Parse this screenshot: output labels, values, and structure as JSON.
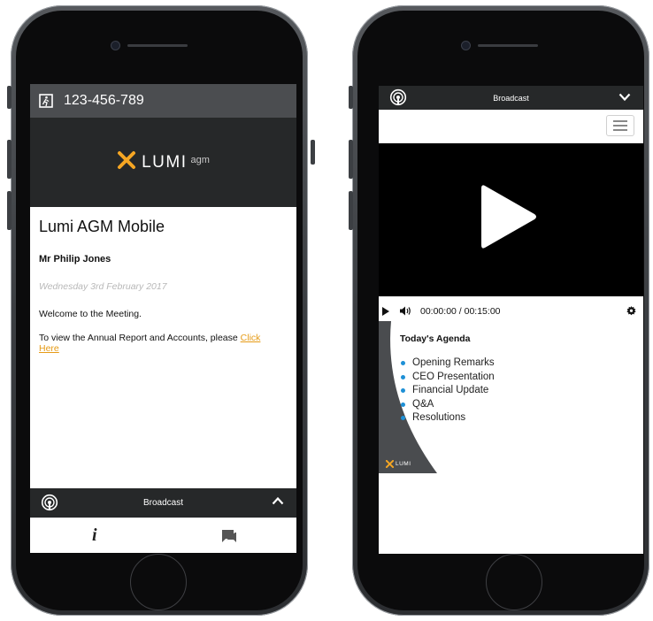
{
  "phone1": {
    "meeting_id": "123-456-789",
    "logo": {
      "brand": "LUMI",
      "sub": "agm"
    },
    "title": "Lumi AGM Mobile",
    "attendee": "Mr Philip Jones",
    "date": "Wednesday 3rd February 2017",
    "welcome": "Welcome to the Meeting.",
    "report_text": "To view the Annual Report and Accounts, please",
    "report_link": "Click Here",
    "broadcast_label": "Broadcast",
    "tab_info_label": "i",
    "icons": {
      "meeting": "exit-door-icon",
      "broadcast": "broadcast-icon",
      "toggle": "chevron-up-icon",
      "chat": "chat-icon"
    }
  },
  "phone2": {
    "broadcast_label": "Broadcast",
    "time": "00:00:00 / 00:15:00",
    "agenda_title": "Today's Agenda",
    "agenda": [
      "Opening Remarks",
      "CEO Presentation",
      "Financial Update",
      "Q&A",
      "Resolutions"
    ],
    "slide_logo": "LUMI",
    "icons": {
      "broadcast": "broadcast-icon",
      "toggle": "chevron-down-icon",
      "menu": "hamburger-icon",
      "play": "play-icon",
      "volume": "volume-icon",
      "settings": "gear-icon"
    }
  },
  "colors": {
    "accent": "#F5A623",
    "link": "#E69B16",
    "bullet": "#1E90D6",
    "bar_dark": "#262829",
    "bar_grey": "#4B4D50"
  }
}
